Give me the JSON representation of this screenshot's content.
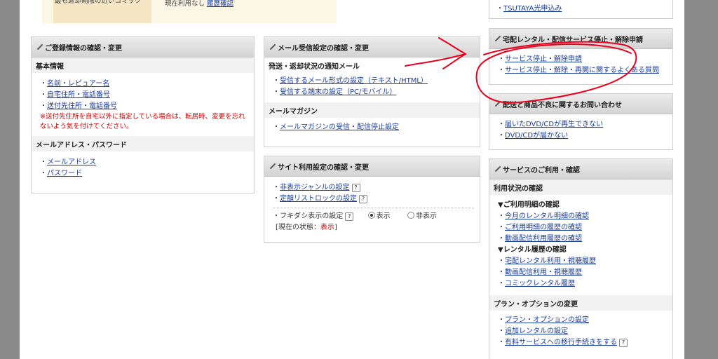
{
  "top": {
    "left_label": "最も返却期限の近いコミック",
    "left_value": "現在利用なし",
    "left_link": "履歴確認",
    "right_link": "TSUTAYA光申込み"
  },
  "registration": {
    "title": "ご登録情報の確認・変更",
    "basic_heading": "基本情報",
    "basic_items": [
      "名前・レビュアー名",
      "自宅住所・電話番号",
      "送付先住所・電話番号"
    ],
    "note": "※送付先住所を自宅以外に指定している場合は、転居時、変更を忘れないよう気を付けてください。",
    "mail_heading": "メールアドレス・パスワード",
    "mail_items": [
      "メールアドレス",
      "パスワード"
    ]
  },
  "mail_settings": {
    "title": "メール受信設定の確認・変更",
    "notice_heading": "発送・返却状況の通知メール",
    "notice_items": [
      "受信するメール形式の設定（テキスト/HTML）",
      "受信する端末の設定（PC/モバイル）"
    ],
    "magazine_heading": "メールマガジン",
    "magazine_items": [
      "メールマガジンの受信・配信停止設定"
    ]
  },
  "site_settings": {
    "title": "サイト利用設定の確認・変更",
    "items": [
      "非表示ジャンルの設定",
      "定額リストロックの設定"
    ],
    "help": "?",
    "fukidashi_label": "フキダシ表示の設定",
    "option_show": "表示",
    "option_hide": "非表示",
    "status_prefix": "[現在の状態：",
    "status_value": "表示",
    "status_suffix": "]"
  },
  "delivery_stop": {
    "title": "宅配レンタル・配信サービス停止・解除申請",
    "items": [
      "サービス停止・解除申請",
      "サービス停止・解除・再開に関するよくある質問"
    ]
  },
  "delivery_inquiry": {
    "title": "配送と商品不良に関するお問い合わせ",
    "items": [
      "届いたDVD/CDが再生できない",
      "DVD/CDが届かない"
    ]
  },
  "service_usage": {
    "title": "サービスのご利用・確認",
    "usage_heading": "利用状況の確認",
    "detail_heading": "▼ご利用明細の確認",
    "detail_items": [
      "今月のレンタル明細の確認",
      "ご利用明細の履歴の確認",
      "動画配信利用履歴の確認"
    ],
    "history_heading": "▼レンタル履歴の確認",
    "history_items": [
      "宅配レンタル利用・視聴履歴",
      "動画配信利用・視聴履歴",
      "コミックレンタル履歴"
    ],
    "plan_heading": "プラン・オプションの変更",
    "plan_items": [
      "プラン・オプションの設定",
      "追加レンタルの設定",
      "有料サービスへの移行手続きをする"
    ]
  },
  "colors": {
    "link": "#1a3c9e",
    "note": "#d20000",
    "annotation": "#e8001c"
  }
}
